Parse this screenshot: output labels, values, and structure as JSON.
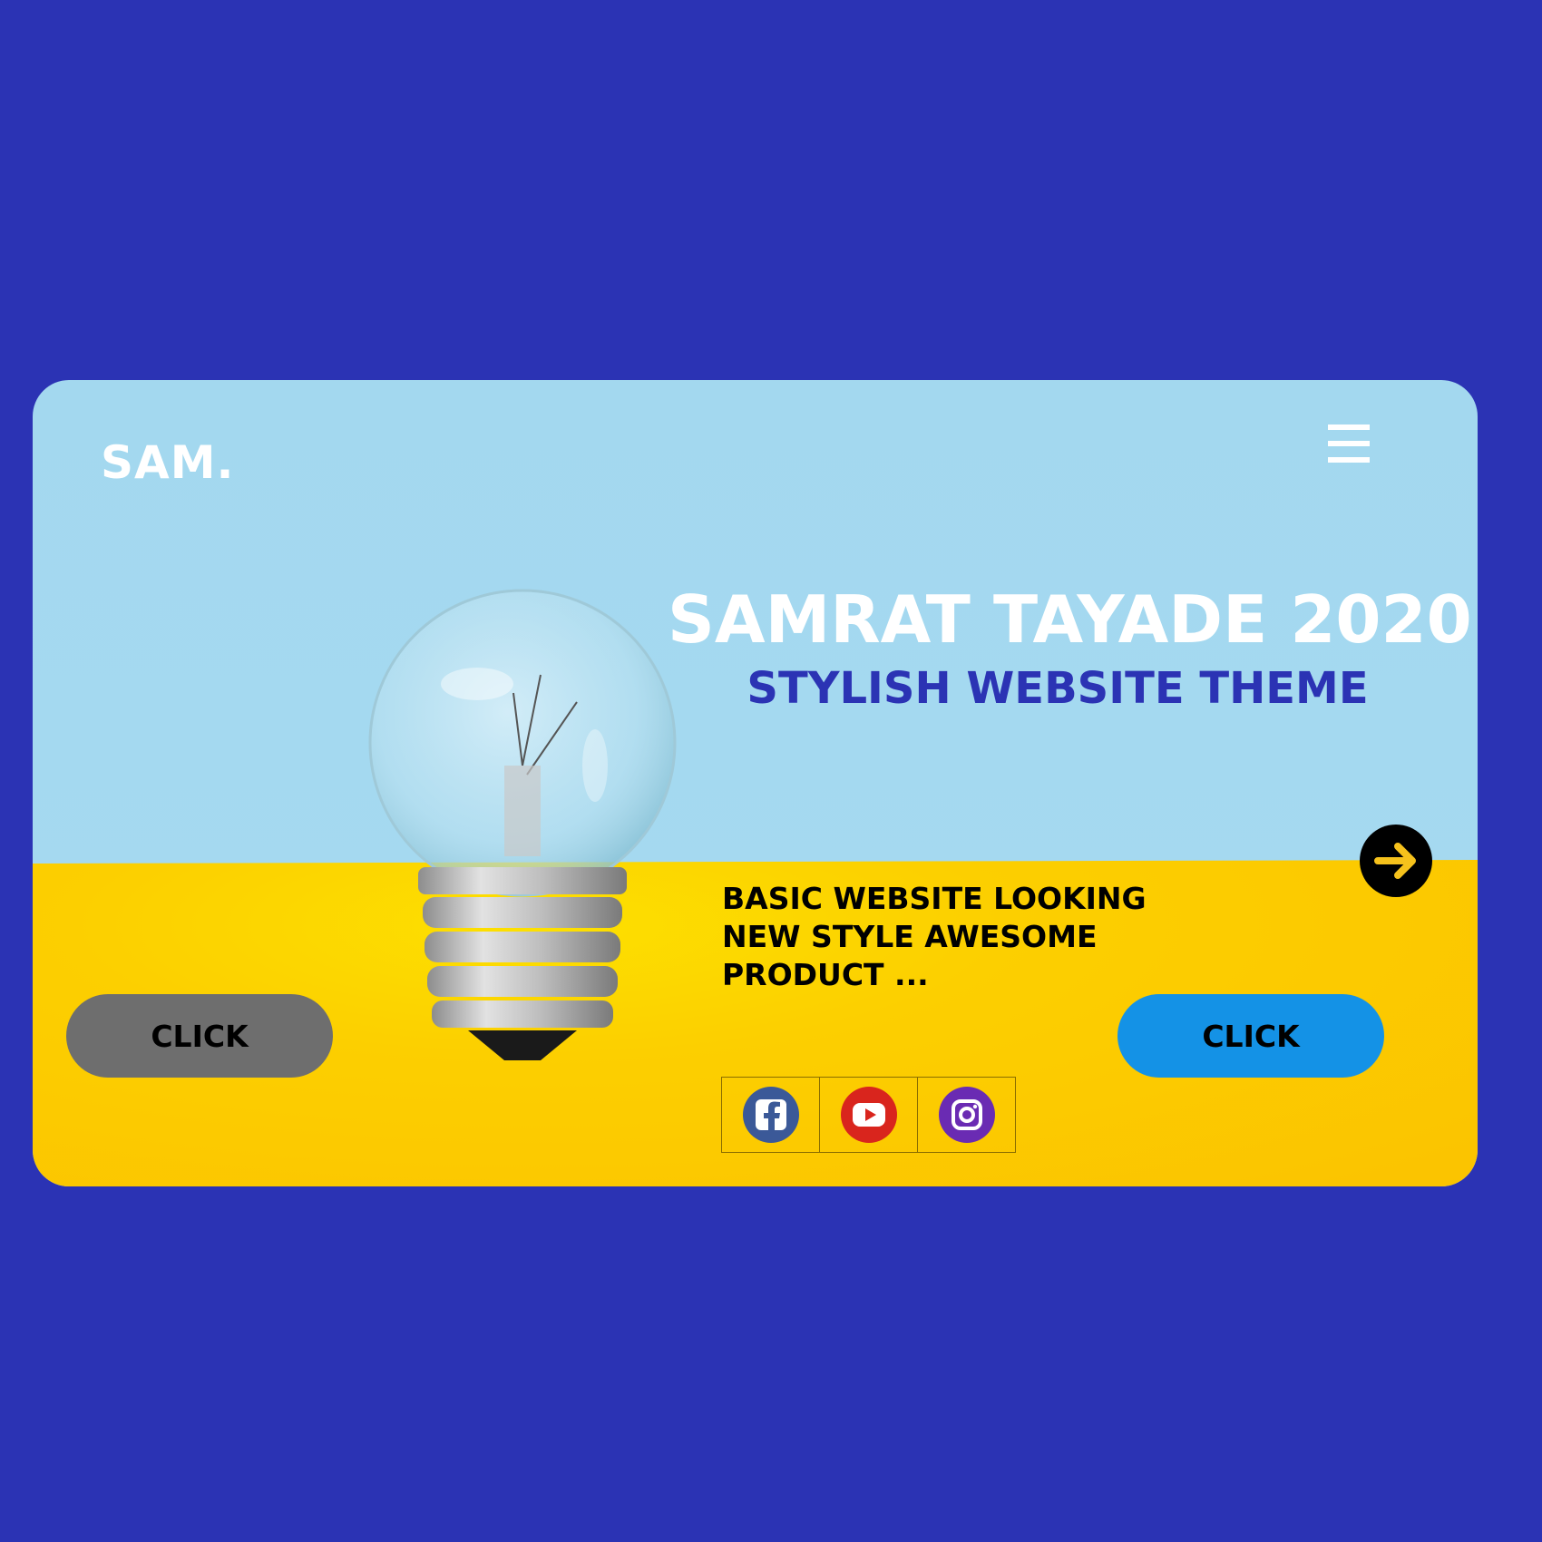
{
  "header": {
    "logo": "SAM.",
    "menu_icon": "hamburger-menu-icon"
  },
  "hero": {
    "title": "SAMRAT TAYADE 2020",
    "subtitle": "STYLISH WEBSITE THEME",
    "description_lines": [
      "BASIC WEBSITE LOOKING",
      "NEW STYLE AWESOME",
      "PRODUCT ..."
    ],
    "next_icon": "arrow-right-circle-icon"
  },
  "buttons": {
    "left_label": "CLICK",
    "right_label": "CLICK"
  },
  "social": [
    {
      "name": "facebook",
      "icon": "facebook-icon"
    },
    {
      "name": "youtube",
      "icon": "youtube-icon"
    },
    {
      "name": "instagram",
      "icon": "instagram-icon"
    }
  ],
  "colors": {
    "page_background": "#2b33b4",
    "sky": "#a3d8ef",
    "floor": "#fccf00",
    "left_button": "#6e6e6e",
    "right_button": "#1492e6",
    "subtitle": "#2b33b4"
  }
}
